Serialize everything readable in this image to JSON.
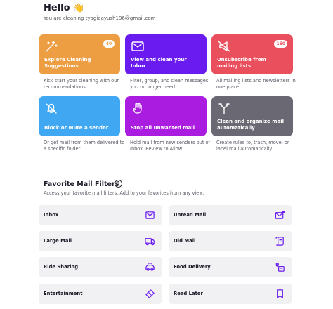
{
  "header": {
    "greeting": "Hello 👋",
    "subtitle": "You are cleaning tyagiaayush196@gmail.com"
  },
  "cards": [
    {
      "label": "Explore Cleaning Suggestions",
      "badge": "40",
      "desc": "Kick start your cleaning with our recommendations.",
      "icon": "magic-wand-icon",
      "color": "#ed9d42"
    },
    {
      "label": "View and clean your Inbox",
      "desc": "Filter, group, and clean messages you no longer need.",
      "icon": "envelope-icon",
      "color": "#6a1bf0"
    },
    {
      "label": "Unsubscribe from mailing lists",
      "badge": "150",
      "desc": "All mailing lists and newsletters in one place.",
      "icon": "muted-megaphone-icon",
      "color": "#ea4f5d"
    },
    {
      "label": "Block or Mute a sender",
      "desc": "Or get mail from them delivered to a specific folder.",
      "icon": "muted-bell-icon",
      "color": "#40a7f2"
    },
    {
      "label": "Stop all unwanted mail",
      "desc": "Hold mail from new senders out of Inbox. Review to Allow.",
      "icon": "hand-stop-icon",
      "color": "#aa1ce0"
    },
    {
      "label": "Clean and organize mail automatically",
      "desc": "Create rules to, trash, move, or label mail automatically.",
      "icon": "rules-split-icon",
      "color": "#6a6872"
    }
  ],
  "filters_section": {
    "title": "Favorite Mail Filters",
    "help": "?",
    "subtitle": "Access your favorite mail filters. Add to your favorites from any view."
  },
  "filters": [
    {
      "label": "Inbox",
      "icon": "inbox-icon"
    },
    {
      "label": "Unread Mail",
      "icon": "unread-mail-icon"
    },
    {
      "label": "Large Mail",
      "icon": "truck-icon"
    },
    {
      "label": "Old Mail",
      "icon": "scroll-icon"
    },
    {
      "label": "Ride Sharing",
      "icon": "car-icon"
    },
    {
      "label": "Food Delivery",
      "icon": "food-delivery-icon"
    },
    {
      "label": "Entertainment",
      "icon": "ticket-icon"
    },
    {
      "label": "Read Later",
      "icon": "bookmark-icon"
    }
  ],
  "colors": {
    "accent": "#6a1bf0",
    "filter_icon": "#6a1bf0"
  }
}
